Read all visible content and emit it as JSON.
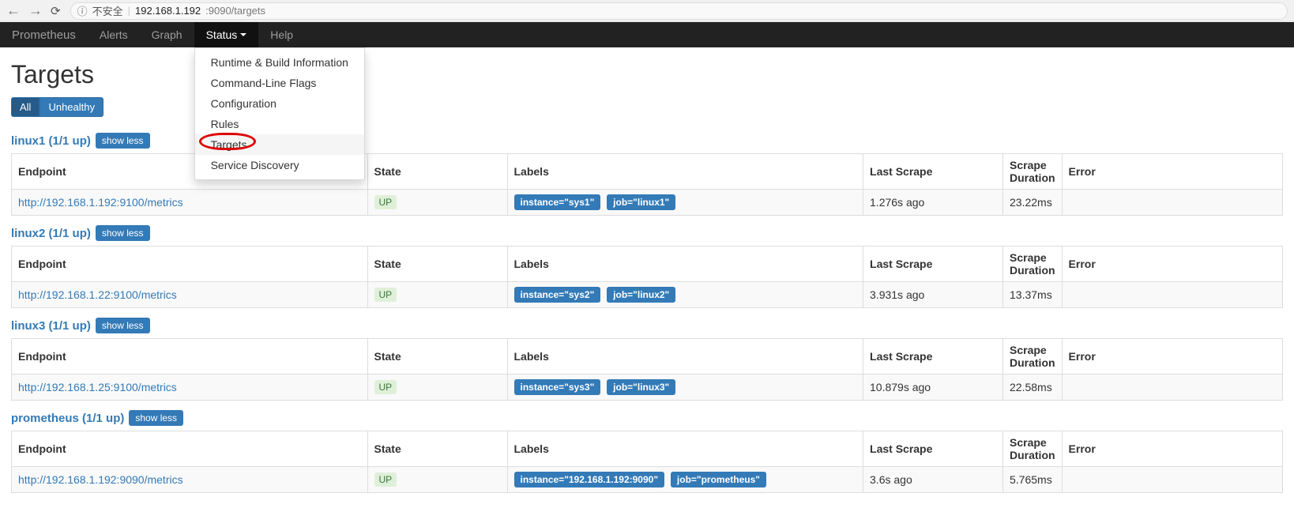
{
  "browser": {
    "security": "不安全",
    "url_host": "192.168.1.192",
    "url_port_path": ":9090/targets"
  },
  "nav": {
    "brand": "Prometheus",
    "alerts": "Alerts",
    "graph": "Graph",
    "status": "Status",
    "help": "Help"
  },
  "status_menu": {
    "runtime": "Runtime & Build Information",
    "cmdline": "Command-Line Flags",
    "config": "Configuration",
    "rules": "Rules",
    "targets": "Targets",
    "sd": "Service Discovery"
  },
  "page": {
    "title": "Targets",
    "filter_all": "All",
    "filter_unhealthy": "Unhealthy",
    "show_less": "show less"
  },
  "table_headers": {
    "endpoint": "Endpoint",
    "state": "State",
    "labels": "Labels",
    "last_scrape": "Last Scrape",
    "scrape_duration": "Scrape Duration",
    "error": "Error"
  },
  "jobs": [
    {
      "name": "linux1 (1/1 up)",
      "endpoint": "http://192.168.1.192:9100/metrics",
      "state": "UP",
      "label_instance": "instance=\"sys1\"",
      "label_job": "job=\"linux1\"",
      "last_scrape": "1.276s ago",
      "duration": "23.22ms",
      "error": ""
    },
    {
      "name": "linux2 (1/1 up)",
      "endpoint": "http://192.168.1.22:9100/metrics",
      "state": "UP",
      "label_instance": "instance=\"sys2\"",
      "label_job": "job=\"linux2\"",
      "last_scrape": "3.931s ago",
      "duration": "13.37ms",
      "error": ""
    },
    {
      "name": "linux3 (1/1 up)",
      "endpoint": "http://192.168.1.25:9100/metrics",
      "state": "UP",
      "label_instance": "instance=\"sys3\"",
      "label_job": "job=\"linux3\"",
      "last_scrape": "10.879s ago",
      "duration": "22.58ms",
      "error": ""
    },
    {
      "name": "prometheus (1/1 up)",
      "endpoint": "http://192.168.1.192:9090/metrics",
      "state": "UP",
      "label_instance": "instance=\"192.168.1.192:9090\"",
      "label_job": "job=\"prometheus\"",
      "last_scrape": "3.6s ago",
      "duration": "5.765ms",
      "error": ""
    }
  ]
}
